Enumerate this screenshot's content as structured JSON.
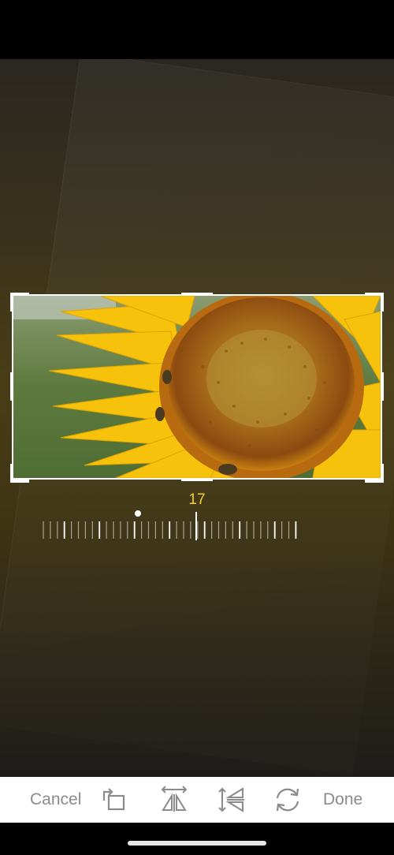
{
  "editor": {
    "angle_value": "17",
    "dial": {
      "current": 17,
      "min": -45,
      "max": 45,
      "reference": 0
    }
  },
  "toolbar": {
    "cancel_label": "Cancel",
    "done_label": "Done",
    "icons": [
      "rotate-icon",
      "flip-horizontal-icon",
      "flip-vertical-icon",
      "rotate-arrows-icon"
    ]
  },
  "colors": {
    "accent": "#f2d22b",
    "toolbar_text": "#8a8a8f",
    "toolbar_bg": "#ffffff"
  }
}
